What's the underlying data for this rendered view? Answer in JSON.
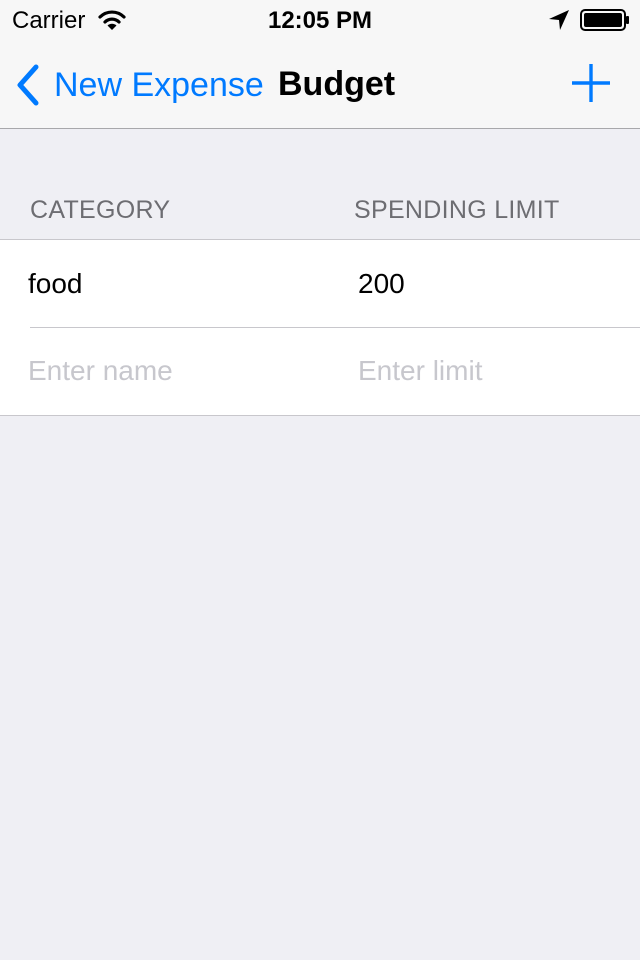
{
  "status_bar": {
    "carrier": "Carrier",
    "time": "12:05 PM",
    "icons": [
      "wifi-icon",
      "location-icon",
      "battery-icon"
    ]
  },
  "nav": {
    "back_label": "New Expense",
    "title": "Budget",
    "back_icon": "chevron-left-icon",
    "add_icon": "plus-icon"
  },
  "table": {
    "headers": [
      "CATEGORY",
      "SPENDING LIMIT"
    ],
    "rows": [
      {
        "category": "food",
        "limit": "200"
      }
    ],
    "new_row": {
      "name_placeholder": "Enter name",
      "limit_placeholder": "Enter limit"
    }
  },
  "colors": {
    "accent": "#007aff",
    "background": "#efeff4",
    "bar": "#f7f7f7",
    "header_text": "#6d6d72",
    "placeholder": "#c7c7cd",
    "separator": "#c8c7cc"
  }
}
